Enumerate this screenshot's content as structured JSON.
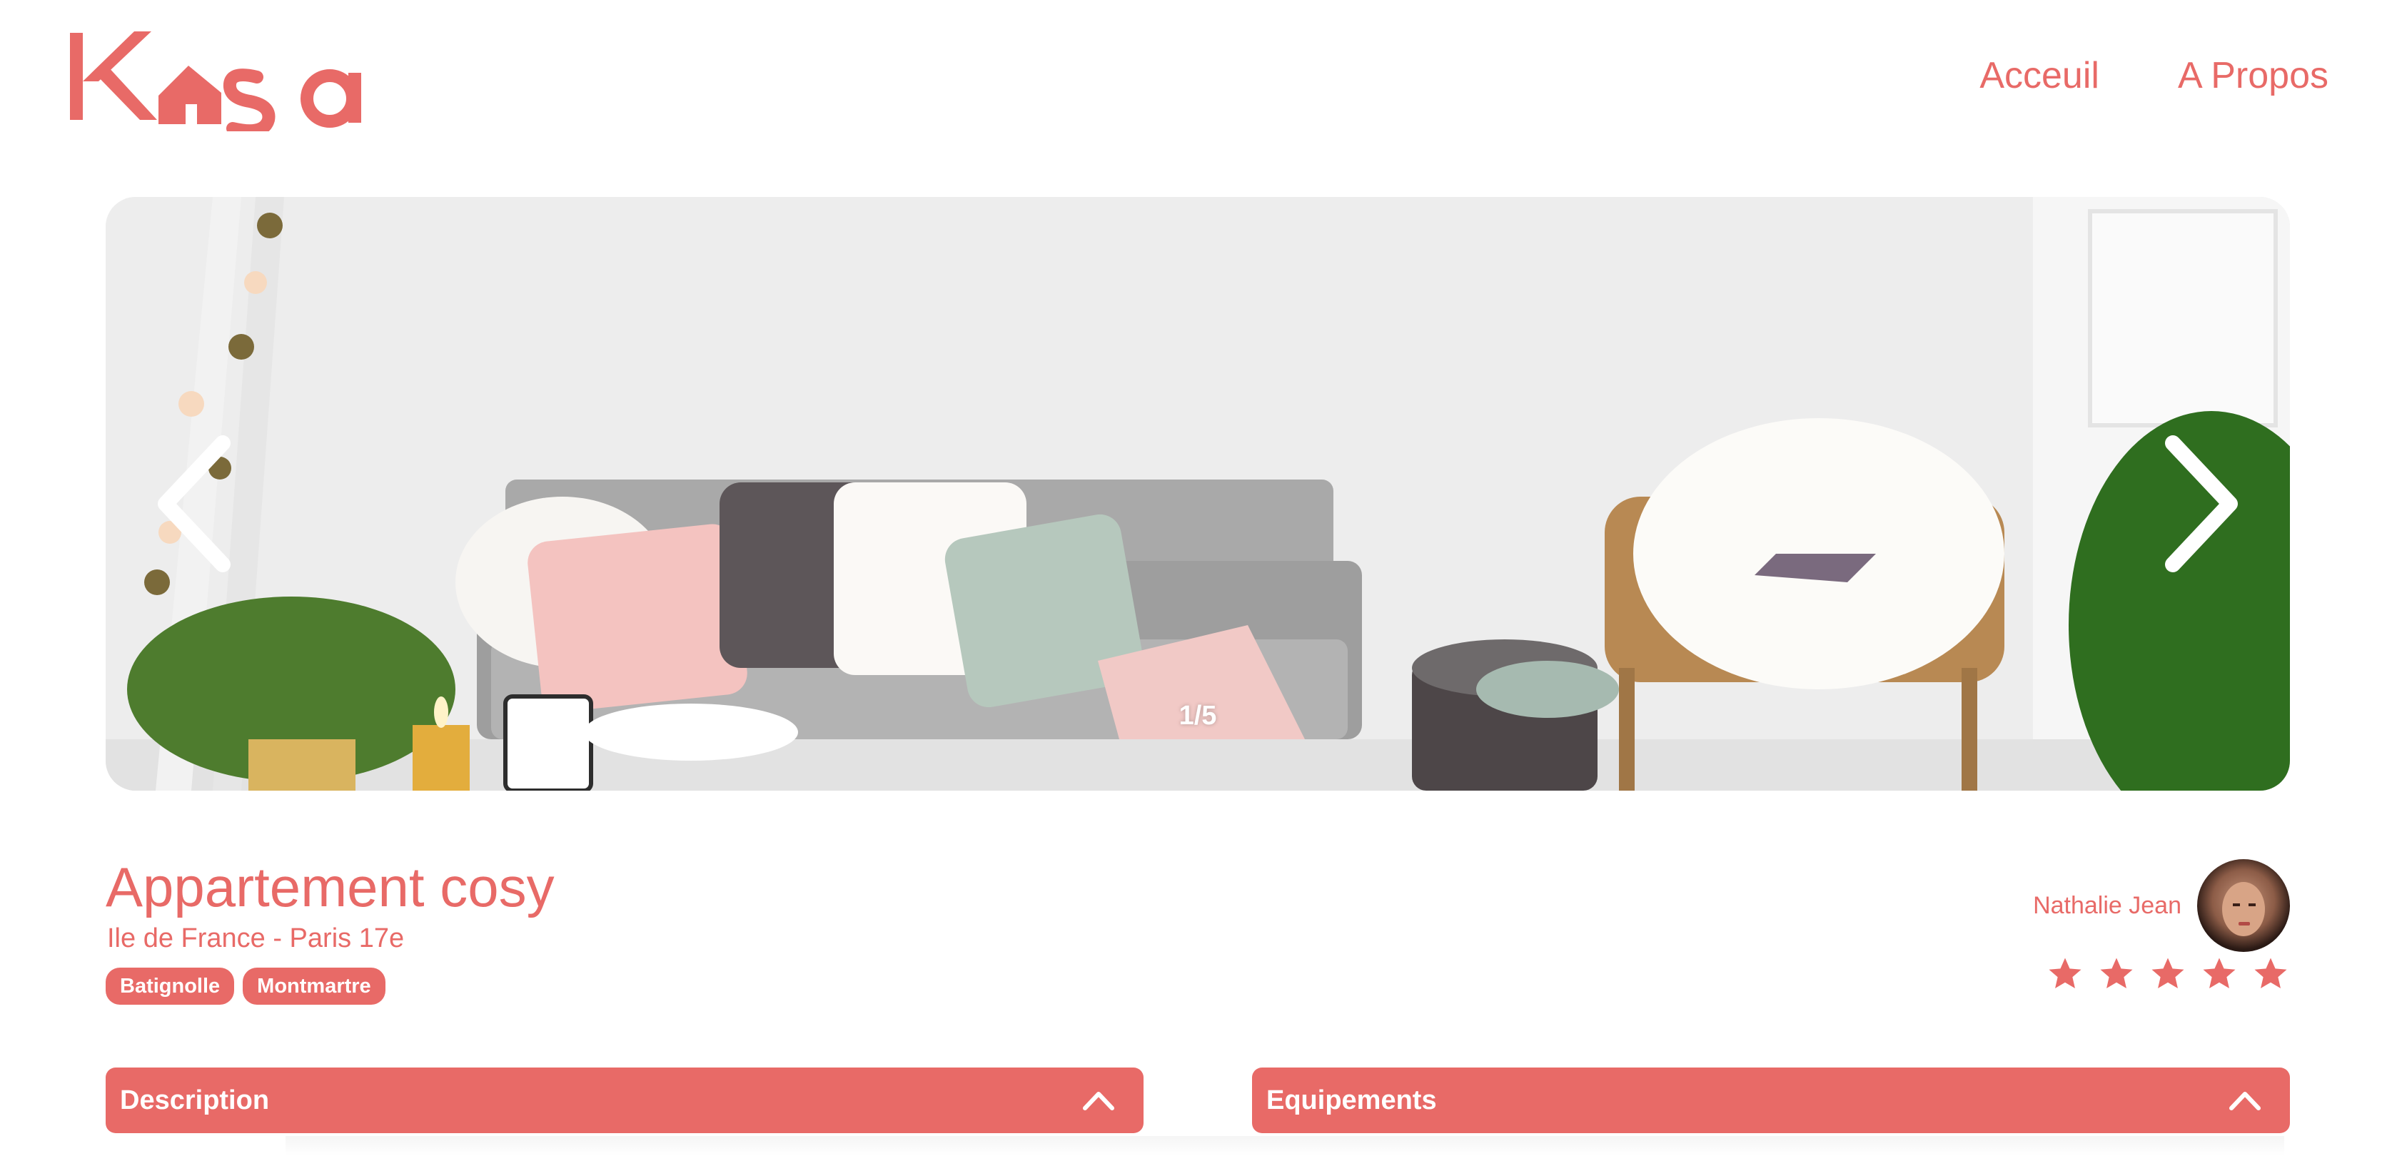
{
  "header": {
    "logo_text": "Kasa",
    "nav": [
      {
        "label": "Acceuil"
      },
      {
        "label": "A Propos"
      }
    ]
  },
  "carousel": {
    "counter": "1/5",
    "current": 1,
    "total": 5
  },
  "listing": {
    "title": "Appartement cosy",
    "location": "Ile de France - Paris 17e",
    "tags": [
      "Batignolle",
      "Montmartre"
    ],
    "host_name": "Nathalie Jean",
    "rating": 5,
    "rating_max": 5
  },
  "sections": {
    "description_label": "Description",
    "equipments_label": "Equipements"
  },
  "colors": {
    "accent": "#E86A67",
    "background": "#FFFFFF"
  },
  "icons": {
    "prev": "chevron-left-icon",
    "next": "chevron-right-icon",
    "collapse": "chevron-up-icon",
    "star": "star-icon"
  }
}
